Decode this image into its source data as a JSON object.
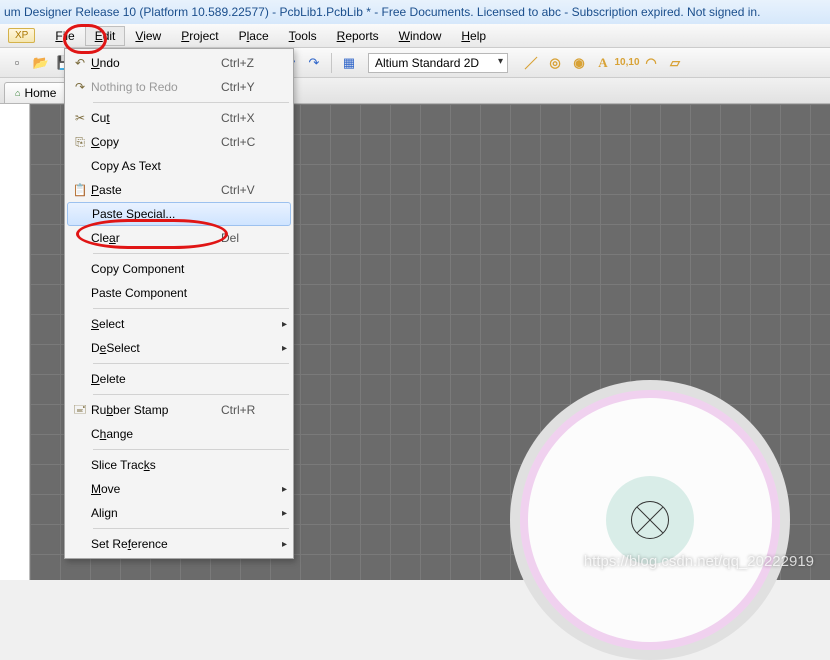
{
  "title": "um Designer Release 10 (Platform 10.589.22577) - PcbLib1.PcbLib * - Free Documents. Licensed to abc - Subscription expired. Not signed in.",
  "dxp_chip": "XP",
  "menus": {
    "file": {
      "pre": "",
      "u": "F",
      "post": "ile"
    },
    "edit": {
      "pre": "",
      "u": "E",
      "post": "dit"
    },
    "view": {
      "pre": "",
      "u": "V",
      "post": "iew"
    },
    "project": {
      "pre": "",
      "u": "P",
      "post": "roject"
    },
    "place": {
      "pre": "P",
      "u": "l",
      "post": "ace"
    },
    "tools": {
      "pre": "",
      "u": "T",
      "post": "ools"
    },
    "reports": {
      "pre": "",
      "u": "R",
      "post": "eports"
    },
    "window": {
      "pre": "",
      "u": "W",
      "post": "indow"
    },
    "help": {
      "pre": "",
      "u": "H",
      "post": "elp"
    }
  },
  "toolbar": {
    "view_combo": "Altium Standard 2D"
  },
  "tabs": {
    "home": "Home"
  },
  "edit_menu": {
    "undo": {
      "label_pre": "",
      "u": "U",
      "label_post": "ndo",
      "sc": "Ctrl+Z",
      "icon": "↶"
    },
    "redo": {
      "label_pre": "Nothing to ",
      "u": "",
      "label_post": "Redo",
      "sc": "Ctrl+Y",
      "icon": "↷"
    },
    "cut": {
      "label_pre": "Cu",
      "u": "t",
      "label_post": "",
      "sc": "Ctrl+X",
      "icon": "✂"
    },
    "copy": {
      "label_pre": "",
      "u": "C",
      "label_post": "opy",
      "sc": "Ctrl+C",
      "icon": "⎘"
    },
    "copy_as_text": {
      "label_pre": "Copy As Text",
      "u": "",
      "label_post": "",
      "sc": "",
      "icon": ""
    },
    "paste": {
      "label_pre": "",
      "u": "P",
      "label_post": "aste",
      "sc": "Ctrl+V",
      "icon": "📋"
    },
    "paste_special": {
      "label_pre": "Paste Spec",
      "u": "i",
      "label_post": "al...",
      "sc": "",
      "icon": ""
    },
    "clear": {
      "label_pre": "Cle",
      "u": "a",
      "label_post": "r",
      "sc": "Del",
      "icon": ""
    },
    "copy_component": {
      "label_pre": "Copy Component",
      "u": "",
      "label_post": "",
      "sc": "",
      "icon": ""
    },
    "paste_component": {
      "label_pre": "Paste Component",
      "u": "",
      "label_post": "",
      "sc": "",
      "icon": ""
    },
    "select": {
      "label_pre": "",
      "u": "S",
      "label_post": "elect",
      "sc": "",
      "icon": "",
      "sub": true
    },
    "deselect": {
      "label_pre": "D",
      "u": "e",
      "label_post": "Select",
      "sc": "",
      "icon": "",
      "sub": true
    },
    "delete": {
      "label_pre": "",
      "u": "D",
      "label_post": "elete",
      "sc": "",
      "icon": ""
    },
    "rubber_stamp": {
      "label_pre": "Ru",
      "u": "b",
      "label_post": "ber Stamp",
      "sc": "Ctrl+R",
      "icon": "🖃"
    },
    "change": {
      "label_pre": "C",
      "u": "h",
      "label_post": "ange",
      "sc": "",
      "icon": ""
    },
    "slice_tracks": {
      "label_pre": "Slice Trac",
      "u": "k",
      "label_post": "s",
      "sc": "",
      "icon": ""
    },
    "move": {
      "label_pre": "",
      "u": "M",
      "label_post": "ove",
      "sc": "",
      "icon": "",
      "sub": true
    },
    "align": {
      "label_pre": "Ali",
      "u": "g",
      "label_post": "n",
      "sc": "",
      "icon": "",
      "sub": true
    },
    "set_reference": {
      "label_pre": "Set Re",
      "u": "f",
      "label_post": "erence",
      "sc": "",
      "icon": "",
      "sub": true
    }
  },
  "watermark": "https://blog.csdn.net/qq_20222919"
}
